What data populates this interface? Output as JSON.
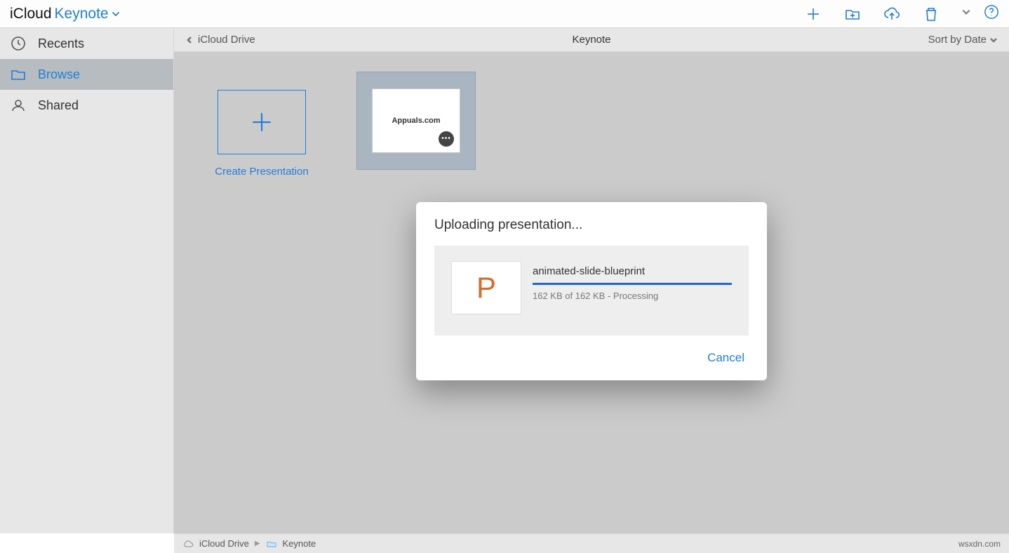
{
  "header": {
    "brand": "iCloud",
    "app_name": "Keynote"
  },
  "sidebar": {
    "items": [
      {
        "label": "Recents"
      },
      {
        "label": "Browse"
      },
      {
        "label": "Shared"
      }
    ]
  },
  "location": {
    "back_label": "iCloud Drive",
    "title": "Keynote",
    "sort_label": "Sort by Date"
  },
  "grid": {
    "create_label": "Create Presentation",
    "doc_thumb_text": "Appuals.com"
  },
  "modal": {
    "title": "Uploading presentation...",
    "file_letter": "P",
    "file_name": "animated-slide-blueprint",
    "status": "162 KB of 162 KB - Processing",
    "cancel_label": "Cancel"
  },
  "footer": {
    "crumb1": "iCloud Drive",
    "crumb2": "Keynote",
    "credit": "wsxdn.com"
  }
}
